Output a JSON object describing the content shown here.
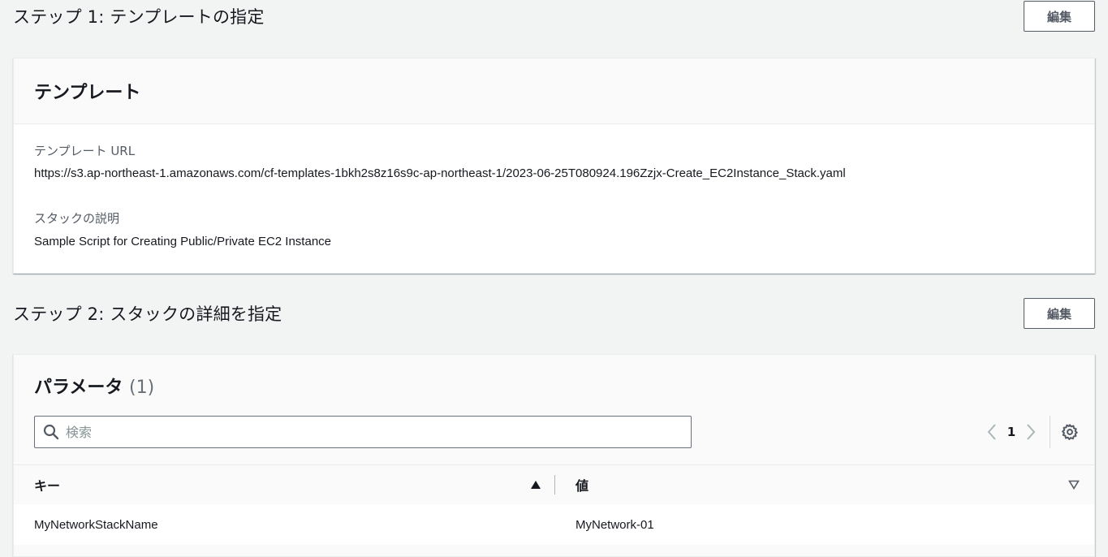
{
  "step1": {
    "title": "ステップ 1: テンプレートの指定",
    "edit_label": "編集",
    "card_title": "テンプレート",
    "url_label": "テンプレート URL",
    "url_value": "https://s3.ap-northeast-1.amazonaws.com/cf-templates-1bkh2s8z16s9c-ap-northeast-1/2023-06-25T080924.196Zzjx-Create_EC2Instance_Stack.yaml",
    "desc_label": "スタックの説明",
    "desc_value": "Sample Script for Creating Public/Private EC2 Instance"
  },
  "step2": {
    "title": "ステップ 2: スタックの詳細を指定",
    "edit_label": "編集",
    "card_title": "パラメータ",
    "count": "(1)",
    "search_placeholder": "検索",
    "page": "1",
    "columns": [
      "キー",
      "値"
    ],
    "rows": [
      {
        "key": "MyNetworkStackName",
        "value": "MyNetwork-01"
      }
    ]
  },
  "icons": {
    "search": "search-icon",
    "prev": "chevron-left-icon",
    "next": "chevron-right-icon",
    "settings": "gear-icon",
    "sort_asc": "caret-up-icon",
    "sort_none": "caret-down-outline-icon"
  },
  "colors": {
    "background": "#f2f3f3",
    "text": "#16191f",
    "muted": "#545b64"
  }
}
